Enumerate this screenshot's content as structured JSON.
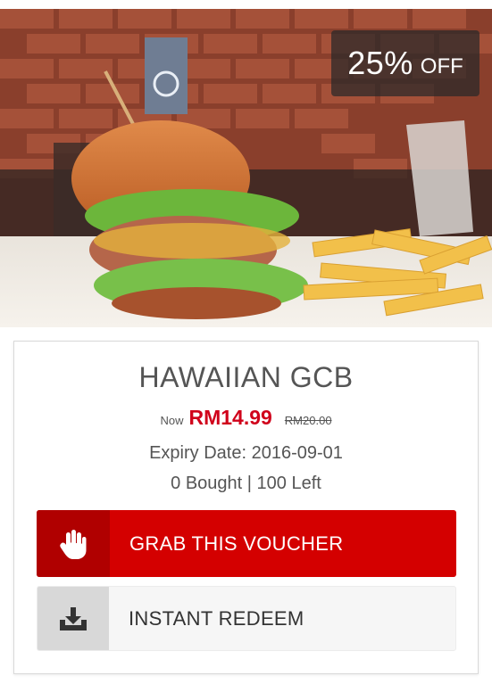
{
  "deal": {
    "discount_value": "25%",
    "discount_suffix": "OFF",
    "title": "HAWAIIAN GCB",
    "price_now_label": "Now",
    "price_now": "RM14.99",
    "price_old": "RM20.00",
    "expiry_label": "Expiry Date:",
    "expiry_date": "2016-09-01",
    "bought_count": "0 Bought",
    "separator": "|",
    "left_count": "100 Left"
  },
  "actions": {
    "grab_label": "GRAB THIS VOUCHER",
    "grab_icon": "hand-stop-icon",
    "redeem_label": "INSTANT REDEEM",
    "redeem_icon": "download-tray-icon"
  },
  "colors": {
    "accent_red": "#d40000",
    "price_red": "#d0021b",
    "text_gray": "#555555"
  }
}
